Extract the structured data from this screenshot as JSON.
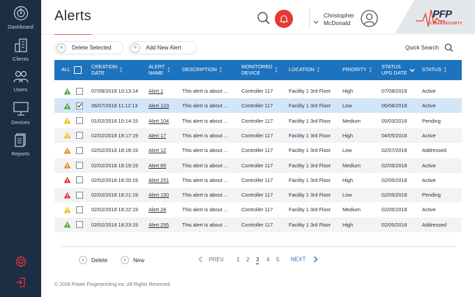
{
  "sidebar": {
    "items": [
      {
        "label": "Dashboard",
        "icon": "radar-icon"
      },
      {
        "label": "Clients",
        "icon": "building-icon"
      },
      {
        "label": "Users",
        "icon": "users-icon"
      },
      {
        "label": "Devices",
        "icon": "monitor-icon"
      },
      {
        "label": "Reports",
        "icon": "report-icon"
      }
    ],
    "settings_icon": "gear-icon",
    "logout_icon": "logout-icon"
  },
  "header": {
    "title": "Alerts",
    "user_first": "Christopher",
    "user_last": "McDonald",
    "logo_text": "PFP",
    "logo_sub": "CYBERSECURITY"
  },
  "toolbar": {
    "delete_selected": "Delete Selected",
    "add_new_alert": "Add New Alert",
    "quick_search": "Quick Search"
  },
  "table": {
    "headers": {
      "all": "ALL",
      "creation_date_1": "CREATION",
      "creation_date_2": "DATE",
      "alert_name_1": "ALERT",
      "alert_name_2": "NAME",
      "description": "DESCRIPTION",
      "monitored_device_1": "MONITORED",
      "monitored_device_2": "DEVICE",
      "location": "LOCATION",
      "priority": "PRIORITY",
      "status_upd_1": "STATUS",
      "status_upd_2": "UPD DATE",
      "status": "STATUS"
    },
    "rows": [
      {
        "severity": "green",
        "checked": false,
        "date": "07/08/2018 10:13:14",
        "name": "Alert 1",
        "desc": "This alert is about ...",
        "device": "Controller 117",
        "location": "Facility 1 3rd Floor",
        "priority": "High",
        "upd": "07/08/2018",
        "status": "Active"
      },
      {
        "severity": "green",
        "checked": true,
        "date": "06/07/2018 11:12:13",
        "name": "Alert 123",
        "desc": "This alert is about ...",
        "device": "Controller 117",
        "location": "Facility 1 3rd Floor",
        "priority": "Low",
        "upd": "06/08/2018",
        "status": "Active"
      },
      {
        "severity": "yellow",
        "checked": false,
        "date": "01/02/2018 10:14:15",
        "name": "Alert 104",
        "desc": "This alert is about ...",
        "device": "Controller 117",
        "location": "Facility 1 3rd Floor",
        "priority": "Medium",
        "upd": "05/03/2018",
        "status": "Pending"
      },
      {
        "severity": "yellow",
        "checked": false,
        "date": "02/02/2018 18:17:19",
        "name": "Alert 17",
        "desc": "This alert is about ...",
        "device": "Controller 117",
        "location": "Facility 1 3rd Floor",
        "priority": "High",
        "upd": "04/05/2018",
        "status": "Active"
      },
      {
        "severity": "orange",
        "checked": false,
        "date": "02/02/2018 18:18:19",
        "name": "Alert 12",
        "desc": "This alert is about ...",
        "device": "Controller 117",
        "location": "Facility 1 3rd Floor",
        "priority": "Low",
        "upd": "02/07/2018",
        "status": "Addressed"
      },
      {
        "severity": "orange",
        "checked": false,
        "date": "02/02/2018 18:19:19",
        "name": "Alert 85",
        "desc": "This alert is about ...",
        "device": "Controller 117",
        "location": "Facility 1 3rd Floor",
        "priority": "Medium",
        "upd": "02/05/2018",
        "status": "Active"
      },
      {
        "severity": "red",
        "checked": false,
        "date": "02/02/2018 18:20:19",
        "name": "Alert 251",
        "desc": "This alert is about ...",
        "device": "Controller 117",
        "location": "Facility 1 3rd Floor",
        "priority": "High",
        "upd": "02/05/2018",
        "status": "Active"
      },
      {
        "severity": "red",
        "checked": false,
        "date": "02/02/2018 18:21:19",
        "name": "Alert 150",
        "desc": "This alert is about ...",
        "device": "Controller 117",
        "location": "Facility 1 3rd Floor",
        "priority": "Low",
        "upd": "02/05/2018",
        "status": "Pending"
      },
      {
        "severity": "yellow",
        "checked": false,
        "date": "02/02/2018 18:22:19",
        "name": "Alert 28",
        "desc": "This alert is about ...",
        "device": "Controller 117",
        "location": "Facility 1 3rd Floor",
        "priority": "Medium",
        "upd": "02/05/2018",
        "status": "Active"
      },
      {
        "severity": "green",
        "checked": false,
        "date": "02/02/2018 18:23:19",
        "name": "Alert 255",
        "desc": "This alert is about ...",
        "device": "Controller 117",
        "location": "Facility 1 3rd Floor",
        "priority": "High",
        "upd": "02/05/2018",
        "status": "Addressed"
      }
    ]
  },
  "footer": {
    "delete": "Delete",
    "new": "New",
    "prev": "PREV",
    "next": "NEXT",
    "pages": [
      "1",
      "2",
      "3",
      "4",
      "5"
    ],
    "current_page": "3",
    "copyright": "© 2018 Power Fingerprinting Inc. All Rights Reserved."
  },
  "colors": {
    "sidebar_bg": "#1d2d44",
    "header_blue": "#1e73be",
    "bell_red": "#e53935",
    "severity_green": "#5aa83a",
    "severity_yellow": "#f0c419",
    "severity_orange": "#ef8a2c",
    "severity_red": "#e0383e"
  }
}
